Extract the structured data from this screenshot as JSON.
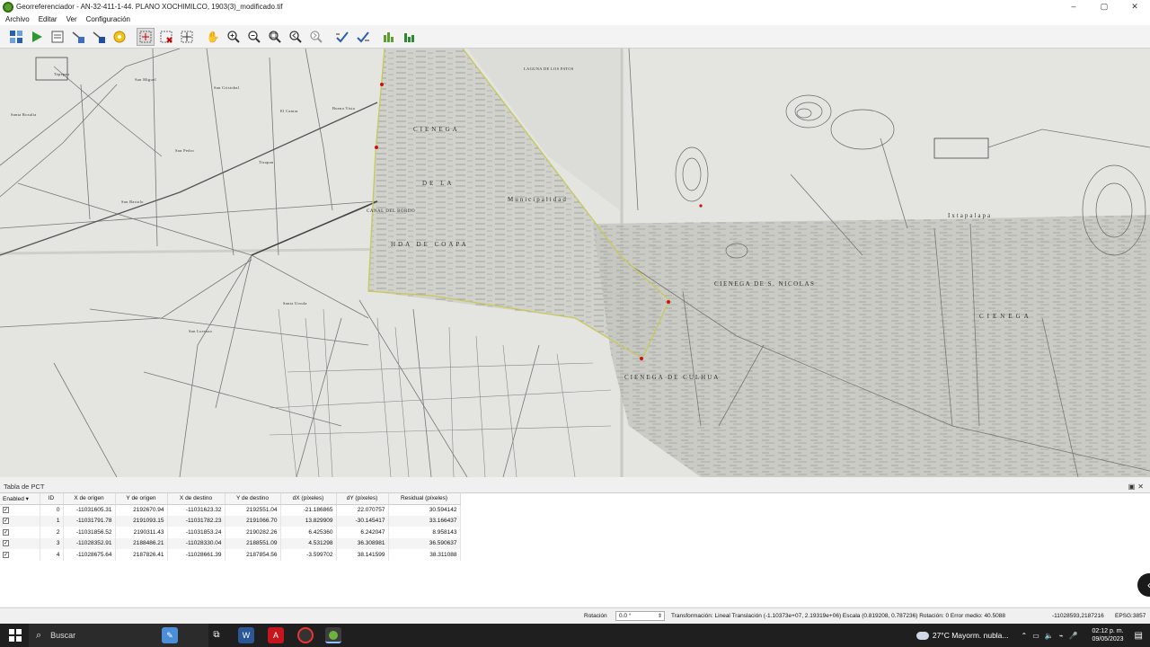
{
  "window": {
    "title": "Georreferenciador - AN-32-411-1-44. PLANO XOCHIMILCO, 1903(3)_modificado.tif",
    "controls": [
      "–",
      "▢",
      "✕"
    ]
  },
  "menu": [
    "Archivo",
    "Editar",
    "Ver",
    "Configuración"
  ],
  "toolbar_icons": [
    "open-raster-icon",
    "start-georeferencing-icon",
    "generate-gdal-script-icon",
    "load-gcp-icon",
    "save-gcp-icon",
    "transformation-settings-icon",
    "add-point-icon",
    "delete-point-icon",
    "move-gcp-icon",
    "pan-icon",
    "zoom-in-icon",
    "zoom-out-icon",
    "zoom-to-layer-icon",
    "zoom-last-icon",
    "zoom-next-icon",
    "link-georef-to-qgis-icon",
    "link-qgis-to-georef-icon",
    "full-histogram-stretch-icon",
    "local-histogram-stretch-icon"
  ],
  "map_labels": [
    "CIENEGA",
    "DE LA",
    "Municipalidad",
    "HDA DE COAPA",
    "CANAL DEL BORDO",
    "Ixtapalapa",
    "CIENEGA DE S. NICOLAS",
    "CIENEGA DE CULHUA",
    "San Miguel",
    "San Cristobal",
    "El Cantar",
    "Buena Vista",
    "Tepepan",
    "Santa Rosalia",
    "San Bartolo",
    "San Pedro",
    "Tizapan",
    "Santa Ursula",
    "San Lorenzo",
    "CIENEGA",
    "LAGUNA DE LOS PATOS"
  ],
  "gcp_panel": {
    "title": "Tabla de PCT",
    "columns": [
      "Enabled",
      "ID",
      "X de origen",
      "Y de origen",
      "X de destino",
      "Y de destino",
      "dX (píxeles)",
      "dY (píxeles)",
      "Residual (píxeles)"
    ],
    "rows": [
      [
        "✓",
        "0",
        "-11031605.31",
        "2192670.94",
        "-11031623.32",
        "2192551.04",
        "-21.186865",
        "22.070757",
        "30.594142"
      ],
      [
        "✓",
        "1",
        "-11031791.78",
        "2191093.15",
        "-11031782.23",
        "2191066.70",
        "13.829909",
        "-30.145417",
        "33.166437"
      ],
      [
        "✓",
        "2",
        "-11031856.52",
        "2190311.43",
        "-11031853.24",
        "2190282.26",
        "6.425360",
        "6.242047",
        "8.958143"
      ],
      [
        "✓",
        "3",
        "-11028352.91",
        "2188486.21",
        "-11028330.04",
        "2188551.09",
        "4.531298",
        "36.308981",
        "36.590637"
      ],
      [
        "✓",
        "4",
        "-11028675.64",
        "2187826.41",
        "-11028661.39",
        "2187854.56",
        "-3.599702",
        "38.141599",
        "38.311088"
      ]
    ]
  },
  "statusbar": {
    "rotation_label": "Rotación",
    "rotation_value": "0.0 °",
    "transformation": "Transformación: Lineal Translación (-1.10373e+07, 2.19319e+06) Escala (0.819208, 0.787236) Rotación: 0 Error medio: 40.5088",
    "coords": "-11028593,2187216",
    "epsg": "EPSG:3857"
  },
  "taskbar": {
    "search_placeholder": "Buscar",
    "weather": "27°C  Mayorm. nubla...",
    "time": "02:12 p. m.",
    "date": "09/05/2023"
  },
  "colors": {
    "gcp_point": "#d01010",
    "georef_line": "#c8c85a",
    "map_paper": "#e6e6e2"
  }
}
